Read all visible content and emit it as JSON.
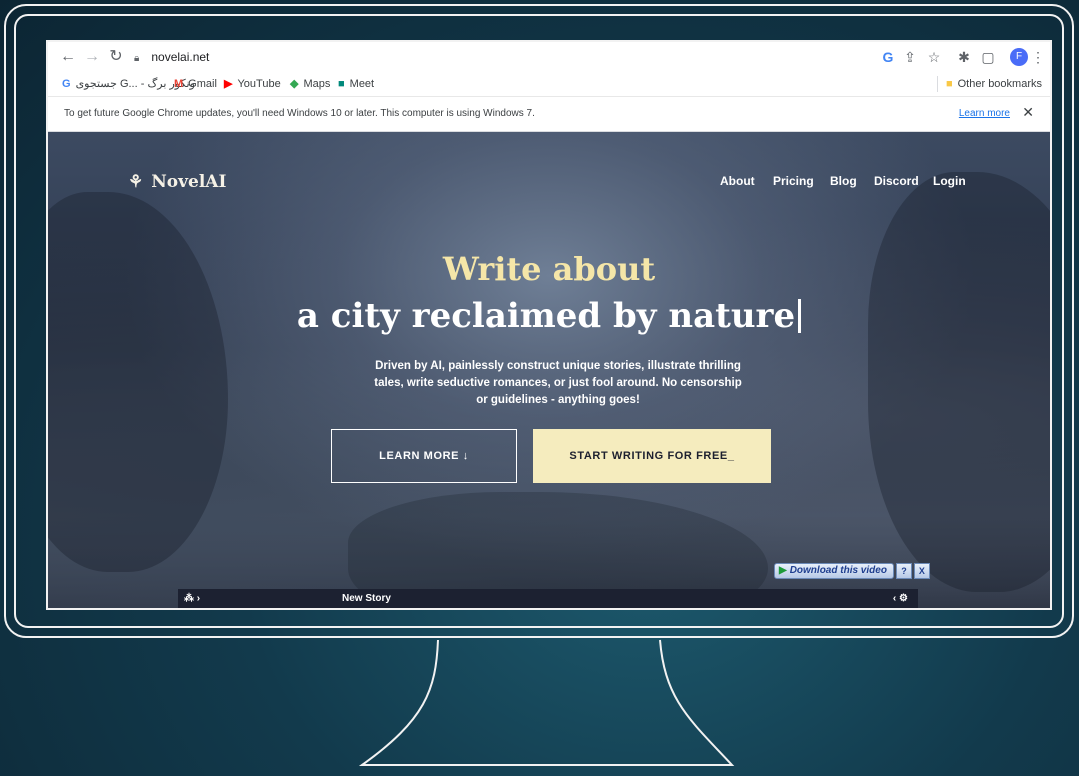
{
  "browser": {
    "url": "novelai.net",
    "avatar_letter": "F",
    "bookmarks": [
      {
        "icon": "G",
        "label": "جستجوی G... - ونکور برگ",
        "color": "#4285f4"
      },
      {
        "icon": "M",
        "label": "Gmail",
        "color": "#ea4335"
      },
      {
        "icon": "▶",
        "label": "YouTube",
        "color": "#ff0000"
      },
      {
        "icon": "◆",
        "label": "Maps",
        "color": "#34a853"
      },
      {
        "icon": "■",
        "label": "Meet",
        "color": "#00897b"
      }
    ],
    "other_bookmarks": "Other bookmarks",
    "infobar": {
      "message": "To get future Google Chrome updates, you'll need Windows 10 or later. This computer is using Windows 7.",
      "learn_more": "Learn more",
      "close": "✕"
    }
  },
  "site": {
    "logo": "NovelAI",
    "nav": [
      "About",
      "Pricing",
      "Blog",
      "Discord",
      "Login"
    ],
    "hero_line1": "Write about",
    "hero_line2": "a city reclaimed by nature",
    "description": "Driven by AI, painlessly construct unique stories, illustrate thrilling tales, write seductive romances, or just fool around. No censorship or guidelines - anything goes!",
    "learn_more_button": "LEARN MORE  ↓",
    "start_button": "START WRITING FOR FREE_",
    "app_bar": {
      "left": "⁂ ›",
      "center": "New Story",
      "right": "‹ ⚙"
    }
  },
  "overlay": {
    "download_label": "Download this video",
    "help": "?",
    "close": "X"
  },
  "colors": {
    "accent_gold": "#f5e6a8",
    "button_fill": "#f5ecbe"
  }
}
